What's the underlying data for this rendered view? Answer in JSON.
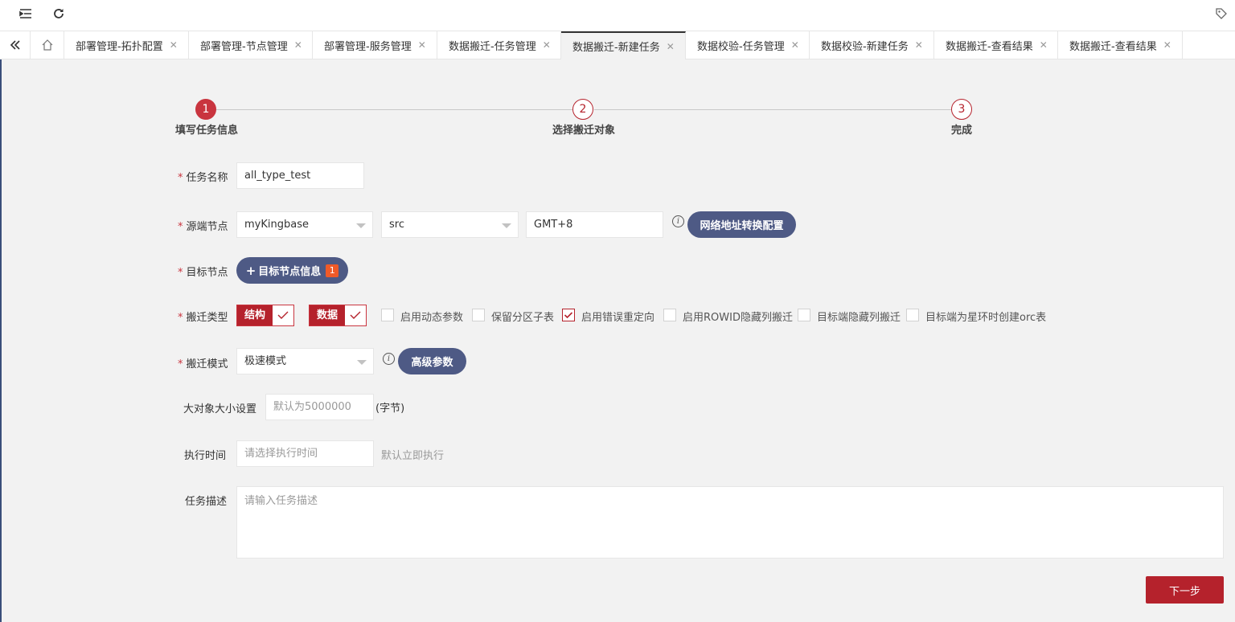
{
  "tabs": [
    {
      "label": "部署管理-拓扑配置",
      "active": false
    },
    {
      "label": "部署管理-节点管理",
      "active": false
    },
    {
      "label": "部署管理-服务管理",
      "active": false
    },
    {
      "label": "数据搬迁-任务管理",
      "active": false
    },
    {
      "label": "数据搬迁-新建任务",
      "active": true
    },
    {
      "label": "数据校验-任务管理",
      "active": false
    },
    {
      "label": "数据校验-新建任务",
      "active": false
    },
    {
      "label": "数据搬迁-查看结果",
      "active": false
    },
    {
      "label": "数据搬迁-查看结果",
      "active": false
    }
  ],
  "steps": [
    {
      "num": "1",
      "label": "填写任务信息",
      "active": true
    },
    {
      "num": "2",
      "label": "选择搬迁对象",
      "active": false
    },
    {
      "num": "3",
      "label": "完成",
      "active": false
    }
  ],
  "form": {
    "required_mark": "*",
    "task_name": {
      "label": "任务名称",
      "value": "all_type_test"
    },
    "source_node": {
      "label": "源端节点",
      "node_value": "myKingbase",
      "schema_value": "src",
      "timezone_value": "GMT+8",
      "network_button": "网络地址转换配置"
    },
    "target_node": {
      "label": "目标节点",
      "button": "目标节点信息",
      "badge": "1"
    },
    "migration_type": {
      "label": "搬迁类型",
      "tag_structure": "结构",
      "tag_data": "数据",
      "options": [
        {
          "label": "启用动态参数",
          "checked": false
        },
        {
          "label": "保留分区子表",
          "checked": false
        },
        {
          "label": "启用错误重定向",
          "checked": true
        },
        {
          "label": "启用ROWID隐藏列搬迁",
          "checked": false
        },
        {
          "label": "目标端隐藏列搬迁",
          "checked": false
        },
        {
          "label": "目标端为星环时创建orc表",
          "checked": false
        }
      ]
    },
    "migration_mode": {
      "label": "搬迁模式",
      "value": "极速模式",
      "advanced_button": "高级参数"
    },
    "lob_size": {
      "label": "大对象大小设置",
      "placeholder": "默认为5000000",
      "unit": "(字节)"
    },
    "exec_time": {
      "label": "执行时间",
      "placeholder": "请选择执行时间",
      "hint": "默认立即执行"
    },
    "description": {
      "label": "任务描述",
      "placeholder": "请输入任务描述"
    }
  },
  "next_button": "下一步",
  "colors": {
    "accent": "#b5222c",
    "pill": "#4e5a85",
    "badge": "#f05a28"
  }
}
